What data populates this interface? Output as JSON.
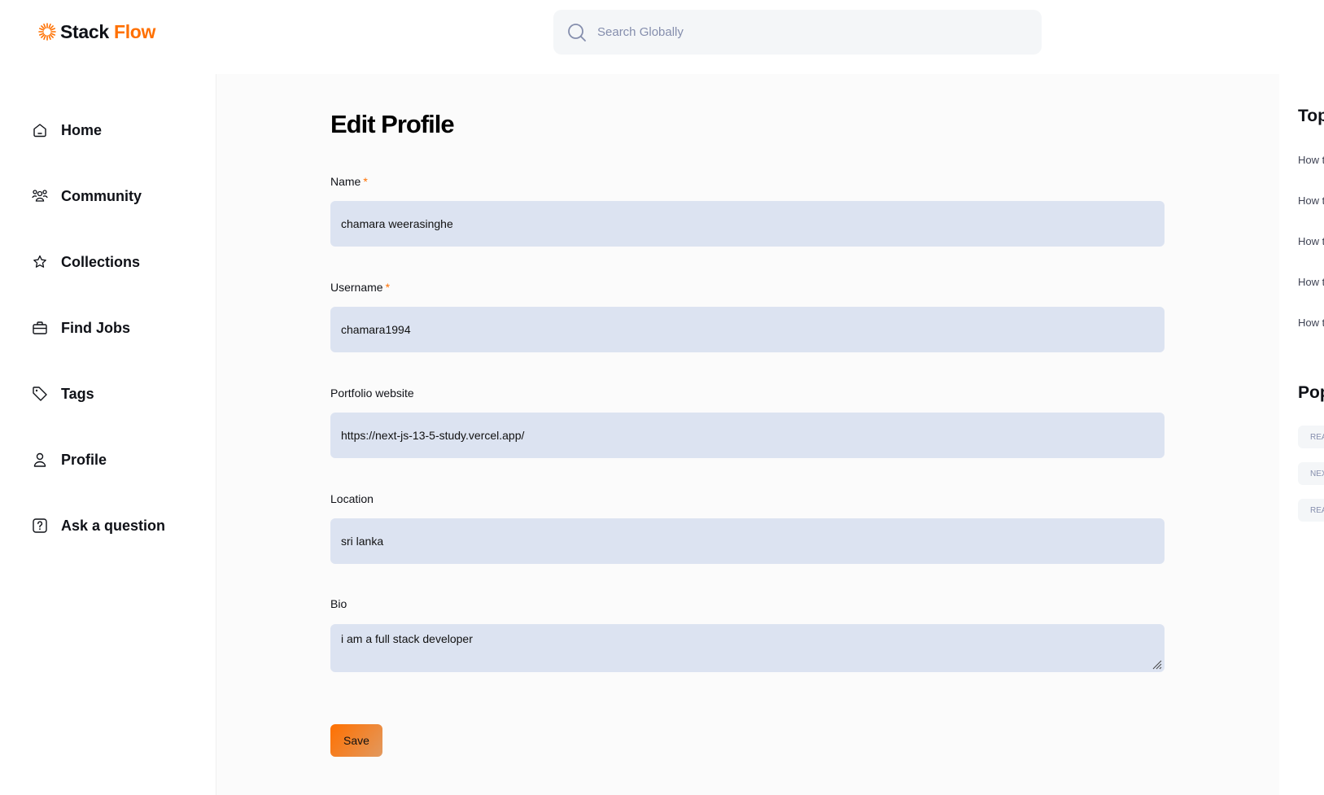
{
  "header": {
    "logo_part1": "Stack",
    "logo_part2": "Flow",
    "search_placeholder": "Search Globally"
  },
  "sidebar": {
    "items": [
      {
        "label": "Home",
        "icon": "home-icon"
      },
      {
        "label": "Community",
        "icon": "users-icon"
      },
      {
        "label": "Collections",
        "icon": "star-icon"
      },
      {
        "label": "Find Jobs",
        "icon": "briefcase-icon"
      },
      {
        "label": "Tags",
        "icon": "tag-icon"
      },
      {
        "label": "Profile",
        "icon": "user-icon"
      },
      {
        "label": "Ask a question",
        "icon": "question-icon"
      }
    ]
  },
  "main": {
    "title": "Edit Profile",
    "required_mark": "*",
    "fields": {
      "name": {
        "label": "Name",
        "value": "chamara weerasinghe"
      },
      "username": {
        "label": "Username",
        "value": "chamara1994"
      },
      "portfolio": {
        "label": "Portfolio website",
        "value": "https://next-js-13-5-study.vercel.app/"
      },
      "location": {
        "label": "Location",
        "value": "sri lanka"
      },
      "bio": {
        "label": "Bio",
        "value": "i am a full stack developer"
      }
    },
    "save_label": "Save"
  },
  "rightbar": {
    "top_heading": "Top",
    "questions": [
      "How t",
      "How t",
      "How t",
      "How t",
      "How t"
    ],
    "popular_heading": "Pop",
    "tags": [
      "REA",
      "NEX",
      "REA"
    ]
  },
  "colors": {
    "accent": "#ff7000",
    "input_bg": "#dce3f1",
    "main_bg": "#fbfbfb"
  }
}
